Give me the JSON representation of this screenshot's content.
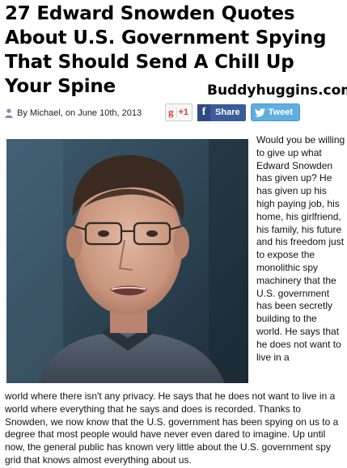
{
  "article": {
    "title": "27 Edward Snowden Quotes About U.S. Government Spying That Should Send A Chill Up Your Spine",
    "site_brand": "Buddyhuggins.com",
    "byline": "By Michael, on June 10th, 2013",
    "side_paragraph": "Would you be willing to give up what Edward Snowden has given up?  He has given up his high paying job, his home, his girlfriend, his family, his future and his freedom just to expose the monolithic spy machinery that the U.S. government has been secretly building to the world.  He says that he does not want to live in a",
    "wide_paragraph": "world where there isn't any privacy.  He says that he does not want to live in a world where everything that he says and does is recorded.  Thanks to Snowden, we now know that the U.S. government has been spying on us to a degree that most people would have never even dared to imagine.  Up until now, the general public has known very little about the U.S. government spy grid that knows almost everything about us."
  },
  "share": {
    "gplus_label": "+1",
    "gplus_icon": "g",
    "facebook_label": "Share",
    "facebook_icon": "f",
    "twitter_label": "Tweet"
  },
  "icons": {
    "author": "person-icon",
    "gplus": "google-plus-icon",
    "facebook": "facebook-icon",
    "twitter": "twitter-bird-icon"
  },
  "colors": {
    "facebook": "#3b5b99",
    "twitter": "#5eaee0",
    "gplus": "#d73d32"
  }
}
